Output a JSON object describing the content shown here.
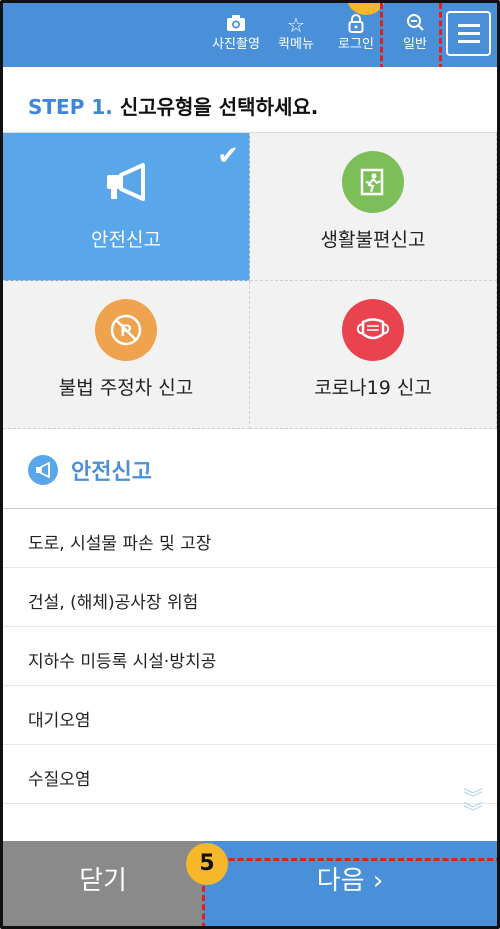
{
  "topbar": {
    "buttons": [
      {
        "label": "사진촬영",
        "icon": "camera-icon"
      },
      {
        "label": "퀵메뉴",
        "icon": "star-icon"
      },
      {
        "label": "로그인",
        "icon": "lock-icon"
      },
      {
        "label": "일반",
        "icon": "zoom-out-icon"
      }
    ],
    "menu_icon": "hamburger-icon",
    "color": "#4a90d9"
  },
  "step": {
    "prefix": "STEP 1.",
    "text": "신고유형을 선택하세요."
  },
  "categories": [
    {
      "label": "안전신고",
      "icon": "megaphone-icon",
      "selected": true,
      "color": "#5aa6ea"
    },
    {
      "label": "생활불편신고",
      "icon": "exit-person-icon",
      "selected": false,
      "color": "#7cbf58"
    },
    {
      "label": "불법 주정차 신고",
      "icon": "no-parking-icon",
      "selected": false,
      "color": "#f0a34e"
    },
    {
      "label": "코로나19 신고",
      "icon": "mask-icon",
      "selected": false,
      "color": "#e8434f"
    }
  ],
  "section": {
    "title": "안전신고",
    "icon": "megaphone-icon"
  },
  "list": [
    "도로, 시설물 파손 및 고장",
    "건설, (해체)공사장 위험",
    "지하수 미등록 시설·방치공",
    "대기오염",
    "수질오염"
  ],
  "bottom": {
    "close_label": "닫기",
    "next_label": "다음 ›"
  },
  "annotation": {
    "badge": "5"
  }
}
